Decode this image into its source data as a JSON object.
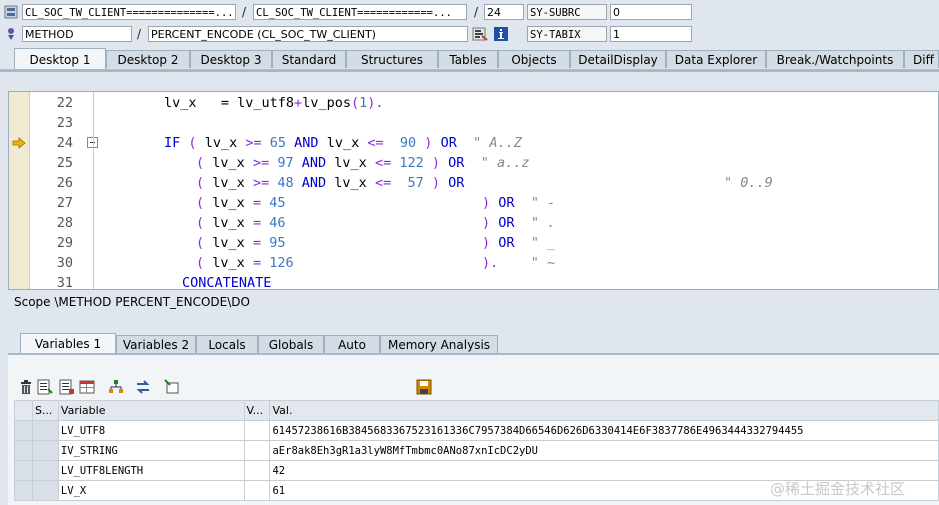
{
  "header": {
    "row1": {
      "class_name": "CL_SOC_TW_CLIENT==============...",
      "include_name": "CL_SOC_TW_CLIENT============...",
      "line": "24",
      "sysvar_label": "SY-SUBRC",
      "sysvar_value": "0"
    },
    "row2": {
      "type": "METHOD",
      "method": "PERCENT_ENCODE (CL_SOC_TW_CLIENT)",
      "sysvar_label": "SY-TABIX",
      "sysvar_value": "1"
    },
    "separator": "/"
  },
  "tabs": [
    {
      "label": "Desktop 1",
      "active": true
    },
    {
      "label": "Desktop 2"
    },
    {
      "label": "Desktop 3"
    },
    {
      "label": "Standard"
    },
    {
      "label": "Structures"
    },
    {
      "label": "Tables"
    },
    {
      "label": "Objects"
    },
    {
      "label": "DetailDisplay"
    },
    {
      "label": "Data Explorer"
    },
    {
      "label": "Break./Watchpoints"
    },
    {
      "label": "Diff"
    }
  ],
  "code": {
    "lines": [
      {
        "n": "22"
      },
      {
        "n": "23"
      },
      {
        "n": "24"
      },
      {
        "n": "25"
      },
      {
        "n": "26"
      },
      {
        "n": "27"
      },
      {
        "n": "28"
      },
      {
        "n": "29"
      },
      {
        "n": "30"
      },
      {
        "n": "31"
      }
    ],
    "tokens": {
      "l22": {
        "a": "lv_x   = lv_utf8",
        "b": "+",
        "c": "lv_pos",
        "d": "(",
        "e": "1",
        "f": ")."
      },
      "kw_if": "IF",
      "kw_and": "AND",
      "kw_or": "OR",
      "kw_concat": "CONCATENATE",
      "paren_open": "(",
      "paren_close": ")",
      "var_x": "lv_x",
      "ge": ">=",
      "le": "<=",
      "eq": "=",
      "dot_close": ").",
      "n65": "65",
      "n90": "90",
      "n97": "97",
      "n122": "122",
      "n48": "48",
      "n57": "57",
      "n45": "45",
      "n46": "46",
      "n95": "95",
      "n126": "126",
      "c24": "\" A..Z",
      "c25": "\" a..z",
      "c26": "\" 0..9",
      "c27": "\" -",
      "c28": "\" .",
      "c29": "\" _",
      "c30": "\" ~"
    }
  },
  "scope_text": "Scope \\METHOD PERCENT_ENCODE\\DO",
  "var_tabs": [
    {
      "label": "Variables 1",
      "active": true
    },
    {
      "label": "Variables 2"
    },
    {
      "label": "Locals"
    },
    {
      "label": "Globals"
    },
    {
      "label": "Auto"
    },
    {
      "label": "Memory Analysis"
    }
  ],
  "grid": {
    "headers": {
      "s": "S...",
      "variable": "Variable",
      "v": "V...",
      "val": "Val."
    },
    "rows": [
      {
        "variable": "LV_UTF8",
        "value": "61457238616B3845683367523161336C7957384D66546D626D6330414E6F3837786E4963444332794455"
      },
      {
        "variable": "IV_STRING",
        "value": "aEr8ak8Eh3gR1a3lyW8MfTmbmc0ANo87xnIcDC2yDU"
      },
      {
        "variable": "LV_UTF8LENGTH",
        "value": "42"
      },
      {
        "variable": "LV_X",
        "value": "61"
      }
    ]
  },
  "watermark": "@稀土掘金技术社区",
  "icons": [
    "object-icon",
    "method-icon",
    "navigate-icon",
    "info-icon",
    "breakpoint-arrow-icon",
    "collapse-icon",
    "delete-icon",
    "detail-icon",
    "list-icon",
    "table-icon",
    "tree-icon",
    "transfer-icon",
    "new-icon",
    "save-icon"
  ]
}
